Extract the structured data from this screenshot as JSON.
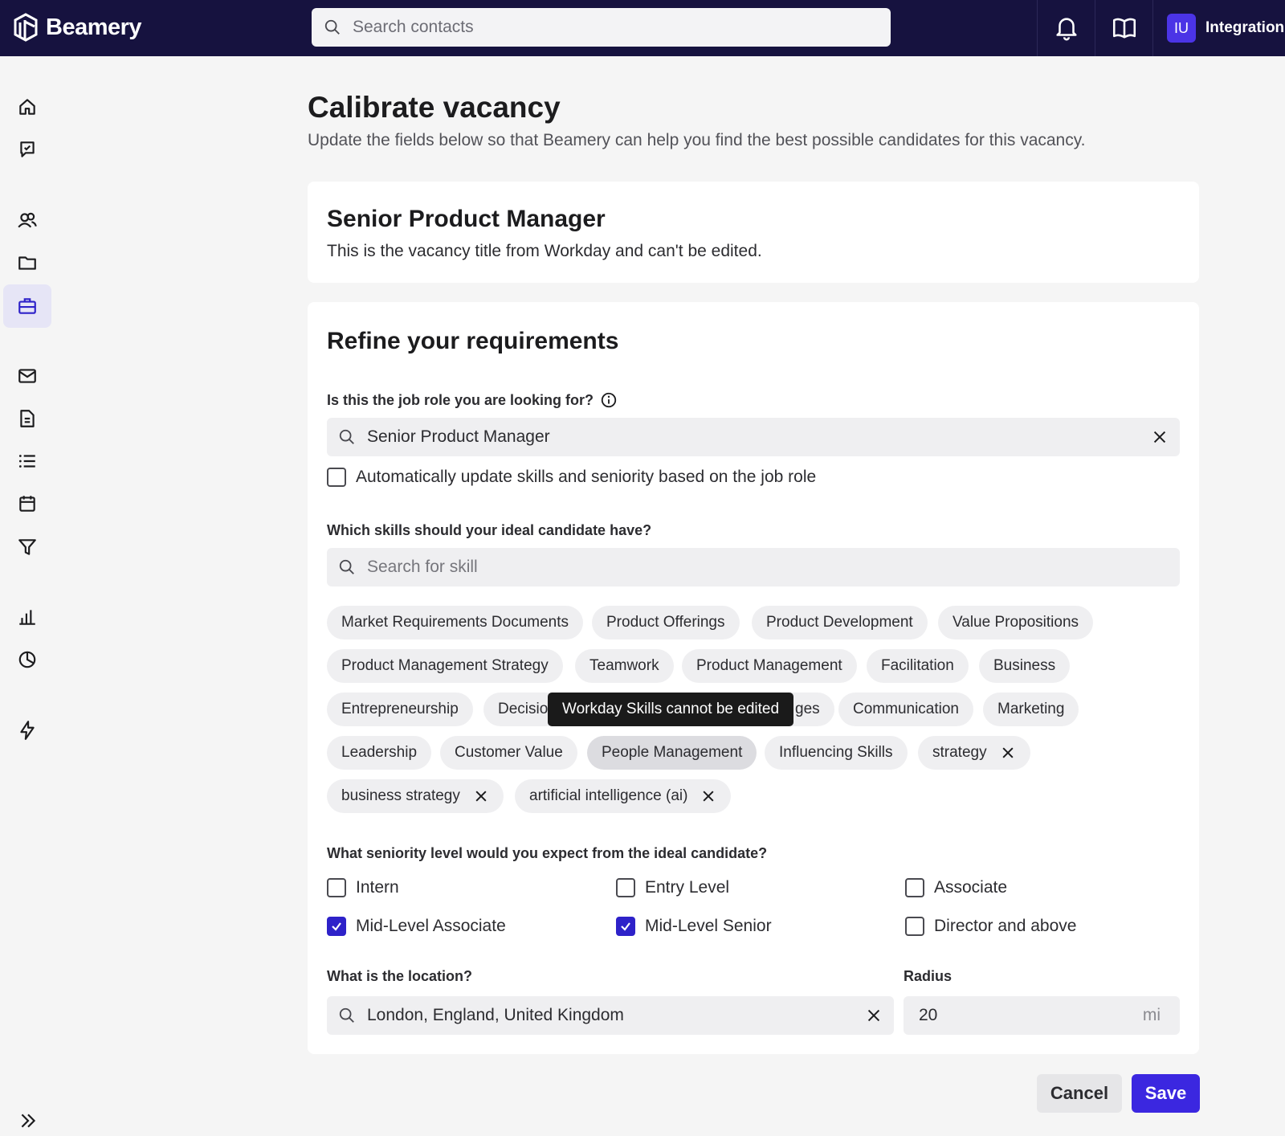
{
  "app": {
    "brand": "Beamery"
  },
  "header": {
    "search_placeholder": "Search contacts",
    "user_initials": "IU",
    "user_name": "Integration"
  },
  "sidebar": {
    "items": [
      {
        "icon": "home-icon"
      },
      {
        "icon": "tasks-icon"
      },
      {
        "icon": "contacts-icon"
      },
      {
        "icon": "folder-icon"
      },
      {
        "icon": "briefcase-icon",
        "active": true
      },
      {
        "icon": "mail-icon"
      },
      {
        "icon": "document-icon"
      },
      {
        "icon": "list-icon"
      },
      {
        "icon": "calendar-icon"
      },
      {
        "icon": "filter-icon"
      },
      {
        "icon": "bar-chart-icon"
      },
      {
        "icon": "pie-chart-icon"
      },
      {
        "icon": "lightning-icon"
      }
    ]
  },
  "page": {
    "title": "Calibrate vacancy",
    "subtitle": "Update the fields below so that Beamery can help you find the best possible candidates for this vacancy."
  },
  "vacancy": {
    "title": "Senior Product Manager",
    "note": "This is the vacancy title from Workday and can't be edited."
  },
  "requirements": {
    "heading": "Refine your requirements",
    "job_role_question": "Is this the job role you are looking for?",
    "job_role_value": "Senior Product Manager",
    "auto_update_label": "Automatically update skills and seniority based on the job role",
    "auto_update_checked": false,
    "skills_question": "Which skills should your ideal candidate have?",
    "skills_placeholder": "Search for skill",
    "skills": [
      "Market Requirements Documents",
      "Product Offerings",
      "Product Development",
      "Value Propositions",
      "Product Management Strategy",
      "Teamwork",
      "Product Management",
      "Facilitation",
      "Business",
      "Entrepreneurship",
      "Decisio",
      "ges",
      "Communication",
      "Marketing",
      "Leadership",
      "Customer Value",
      "People Management",
      "Influencing Skills",
      "strategy",
      "business strategy",
      "artificial intelligence (ai)"
    ],
    "tooltip": "Workday Skills cannot be edited",
    "seniority_question": "What seniority level would you expect from the ideal candidate?",
    "seniority": [
      {
        "label": "Intern",
        "checked": false
      },
      {
        "label": "Entry Level",
        "checked": false
      },
      {
        "label": "Associate",
        "checked": false
      },
      {
        "label": "Mid-Level Associate",
        "checked": true
      },
      {
        "label": "Mid-Level Senior",
        "checked": true
      },
      {
        "label": "Director and above",
        "checked": false
      }
    ],
    "location_question": "What is the location?",
    "location_value": "London, England, United Kingdom",
    "radius_label": "Radius",
    "radius_value": "20",
    "radius_unit": "mi"
  },
  "actions": {
    "cancel": "Cancel",
    "save": "Save"
  },
  "colors": {
    "topbar": "#16123f",
    "accent": "#3b27e0",
    "checkbox_on": "#2e22c9"
  }
}
